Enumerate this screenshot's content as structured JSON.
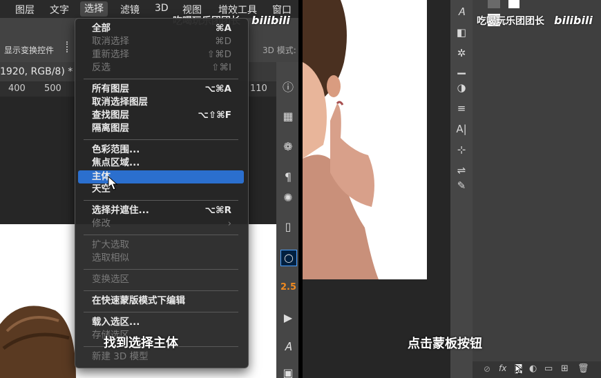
{
  "left": {
    "menubar": [
      "图层",
      "文字",
      "选择",
      "滤镜",
      "3D",
      "视图",
      "增效工具",
      "窗口"
    ],
    "options": {
      "show_transform": "显示变换控件",
      "mode3d": "3D 模式:"
    },
    "doc_tab": "1920, RGB/8) *",
    "ruler": [
      "400",
      "500",
      "110"
    ],
    "watermark": "吃喝玩乐团团长",
    "bili": "bilibili",
    "subtitle": "找到选择主体",
    "toolstrip_value": "2.5"
  },
  "menu": {
    "items": [
      {
        "label": "全部",
        "shortcut": "⌘A",
        "enabled": true
      },
      {
        "label": "取消选择",
        "shortcut": "⌘D",
        "enabled": false
      },
      {
        "label": "重新选择",
        "shortcut": "⇧⌘D",
        "enabled": false
      },
      {
        "label": "反选",
        "shortcut": "⇧⌘I",
        "enabled": false
      },
      {
        "label": "所有图层",
        "shortcut": "⌥⌘A",
        "enabled": true
      },
      {
        "label": "取消选择图层",
        "shortcut": "",
        "enabled": true
      },
      {
        "label": "查找图层",
        "shortcut": "⌥⇧⌘F",
        "enabled": true
      },
      {
        "label": "隔离图层",
        "shortcut": "",
        "enabled": true
      },
      {
        "label": "色彩范围...",
        "shortcut": "",
        "enabled": true
      },
      {
        "label": "焦点区域...",
        "shortcut": "",
        "enabled": true
      },
      {
        "label": "主体",
        "shortcut": "",
        "enabled": true,
        "highlighted": true
      },
      {
        "label": "天空",
        "shortcut": "",
        "enabled": true
      },
      {
        "label": "选择并遮住...",
        "shortcut": "⌥⌘R",
        "enabled": true
      },
      {
        "label": "修改",
        "shortcut": "›",
        "enabled": false
      },
      {
        "label": "扩大选取",
        "shortcut": "",
        "enabled": false
      },
      {
        "label": "选取相似",
        "shortcut": "",
        "enabled": false
      },
      {
        "label": "变换选区",
        "shortcut": "",
        "enabled": false
      },
      {
        "label": "在快速蒙版模式下编辑",
        "shortcut": "",
        "enabled": true
      },
      {
        "label": "载入选区...",
        "shortcut": "",
        "enabled": true
      },
      {
        "label": "存储选区...",
        "shortcut": "",
        "enabled": false
      },
      {
        "label": "新建 3D 模型",
        "shortcut": "",
        "enabled": false
      }
    ]
  },
  "right": {
    "watermark": "吃喝玩乐团团长",
    "bili": "bilibili",
    "subtitle": "点击蒙板按钮",
    "bottom_icons": [
      "link-icon",
      "fx-icon",
      "mask-icon",
      "adjustment-icon",
      "folder-icon",
      "new-layer-icon",
      "trash-icon"
    ]
  }
}
